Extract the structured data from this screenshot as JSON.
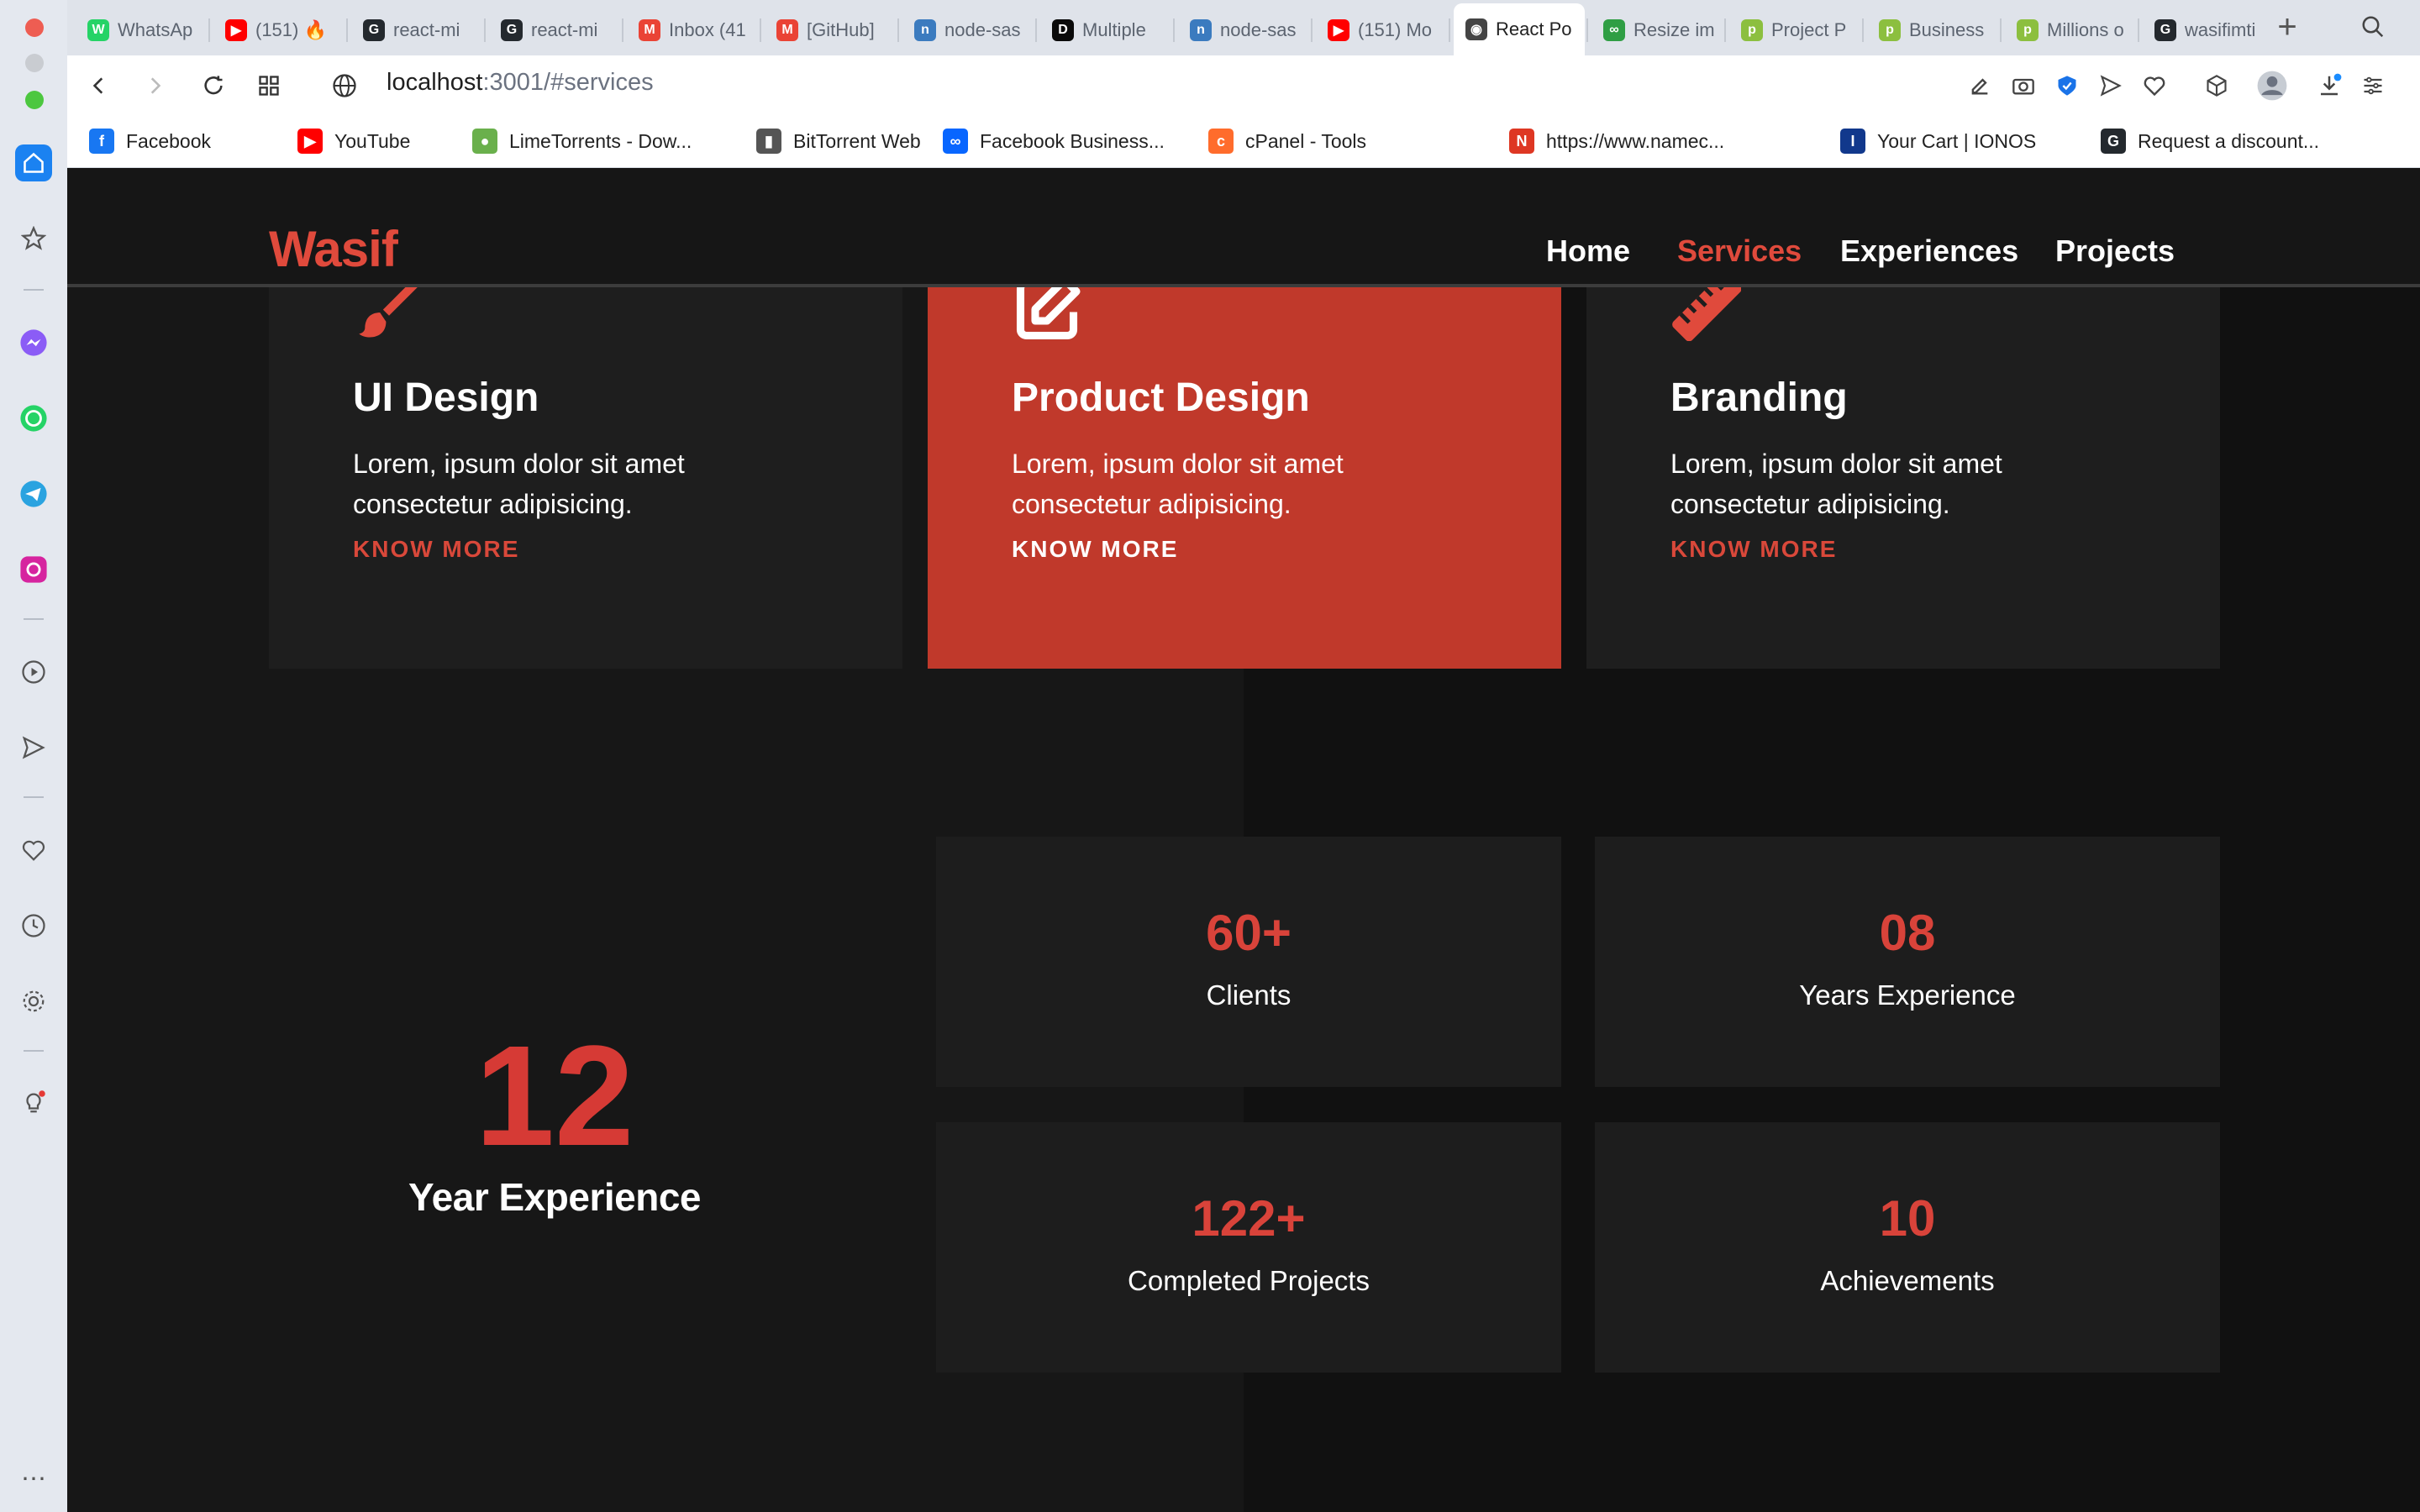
{
  "browser": {
    "tabs": [
      {
        "title": "WhatsAp",
        "color": "#25d366",
        "glyph": "W"
      },
      {
        "title": "(151) 🔥",
        "color": "#ff0000",
        "glyph": "▶"
      },
      {
        "title": "react-mi",
        "color": "#24292e",
        "glyph": "G"
      },
      {
        "title": "react-mi",
        "color": "#24292e",
        "glyph": "G"
      },
      {
        "title": "Inbox (41",
        "color": "#ea4335",
        "glyph": "M"
      },
      {
        "title": "[GitHub]",
        "color": "#ea4335",
        "glyph": "M"
      },
      {
        "title": "node-sas",
        "color": "#3b7bbf",
        "glyph": "n"
      },
      {
        "title": "Multiple",
        "color": "#0a0a0a",
        "glyph": "D"
      },
      {
        "title": "node-sas",
        "color": "#3b7bbf",
        "glyph": "n"
      },
      {
        "title": "(151) Mo",
        "color": "#ff0000",
        "glyph": "▶"
      },
      {
        "title": "React Po",
        "color": "#444444",
        "glyph": "◉"
      },
      {
        "title": "Resize im",
        "color": "#2f9e44",
        "glyph": "∞"
      },
      {
        "title": "Project P",
        "color": "#8cbf3f",
        "glyph": "p"
      },
      {
        "title": "Business",
        "color": "#8cbf3f",
        "glyph": "p"
      },
      {
        "title": "Millions o",
        "color": "#8cbf3f",
        "glyph": "p"
      },
      {
        "title": "wasifimti",
        "color": "#24292e",
        "glyph": "G"
      }
    ],
    "active_tab_index": 10,
    "url_host": "localhost",
    "url_rest": ":3001/#services",
    "bookmarks": [
      {
        "label": "Facebook",
        "color": "#1877f2",
        "glyph": "f"
      },
      {
        "label": "YouTube",
        "color": "#ff0000",
        "glyph": "▶"
      },
      {
        "label": "LimeTorrents - Dow...",
        "color": "#6ab04c",
        "glyph": "●"
      },
      {
        "label": "BitTorrent Web",
        "color": "#555555",
        "glyph": "▮"
      },
      {
        "label": "Facebook Business...",
        "color": "#0866ff",
        "glyph": "∞"
      },
      {
        "label": "cPanel - Tools",
        "color": "#ff6c2c",
        "glyph": "c"
      },
      {
        "label": "https://www.namec...",
        "color": "#de3723",
        "glyph": "N"
      },
      {
        "label": "Your Cart | IONOS",
        "color": "#11388c",
        "glyph": "I"
      },
      {
        "label": "Request a discount...",
        "color": "#24292e",
        "glyph": "G"
      }
    ]
  },
  "site": {
    "logo": "Wasif",
    "nav": [
      {
        "label": "Home",
        "active": false
      },
      {
        "label": "Services",
        "active": true
      },
      {
        "label": "Experiences",
        "active": false
      },
      {
        "label": "Projects",
        "active": false
      }
    ],
    "services": [
      {
        "icon": "paintbrush-icon",
        "title": "UI Design",
        "text": "Lorem, ipsum dolor sit amet consectetur adipisicing.",
        "link": "KNOW MORE",
        "highlight": false
      },
      {
        "icon": "edit-icon",
        "title": "Product Design",
        "text": "Lorem, ipsum dolor sit amet consectetur adipisicing.",
        "link": "KNOW MORE",
        "highlight": true
      },
      {
        "icon": "ruler-icon",
        "title": "Branding",
        "text": "Lorem, ipsum dolor sit amet consectetur adipisicing.",
        "link": "KNOW MORE",
        "highlight": false
      }
    ],
    "experience": {
      "number": "12",
      "label": "Year Experience"
    },
    "stats": [
      {
        "value": "60+",
        "label": "Clients"
      },
      {
        "value": "08",
        "label": "Years Experience"
      },
      {
        "value": "122+",
        "label": "Completed Projects"
      },
      {
        "value": "10",
        "label": "Achievements"
      }
    ],
    "colors": {
      "accent": "#e04a3c",
      "card": "#1e1e1e",
      "highlight": "#c0392b",
      "background": "#141414"
    }
  }
}
